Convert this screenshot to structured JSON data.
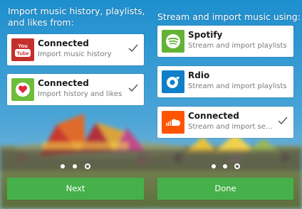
{
  "left_panel": {
    "heading": "Import music history, playlists, and likes from:",
    "cards": [
      {
        "icon": "youtube-icon",
        "title": "Connected",
        "subtitle": "Import music history",
        "checked": true
      },
      {
        "icon": "heart-icon",
        "title": "Connected",
        "subtitle": "Import history and likes",
        "checked": true
      }
    ],
    "pager": {
      "count": 3,
      "active": 2
    },
    "button_label": "Next"
  },
  "right_panel": {
    "heading": "Stream and import music using:",
    "cards": [
      {
        "icon": "spotify-icon",
        "title": "Spotify",
        "subtitle": "Stream and import playlists",
        "checked": false
      },
      {
        "icon": "rdio-icon",
        "title": "Rdio",
        "subtitle": "Stream and import playlists",
        "checked": false
      },
      {
        "icon": "soundcloud-icon",
        "title": "Connected",
        "subtitle": "Stream and import sets…",
        "checked": true
      }
    ],
    "pager": {
      "count": 3,
      "active": 2
    },
    "button_label": "Done"
  },
  "colors": {
    "button_green": "#46b14a",
    "youtube_red": "#c4302b",
    "heart_green": "#6dbe3a",
    "spotify_green": "#62b334",
    "rdio_blue": "#0f7fc9",
    "soundcloud_orange": "#ff5500"
  }
}
